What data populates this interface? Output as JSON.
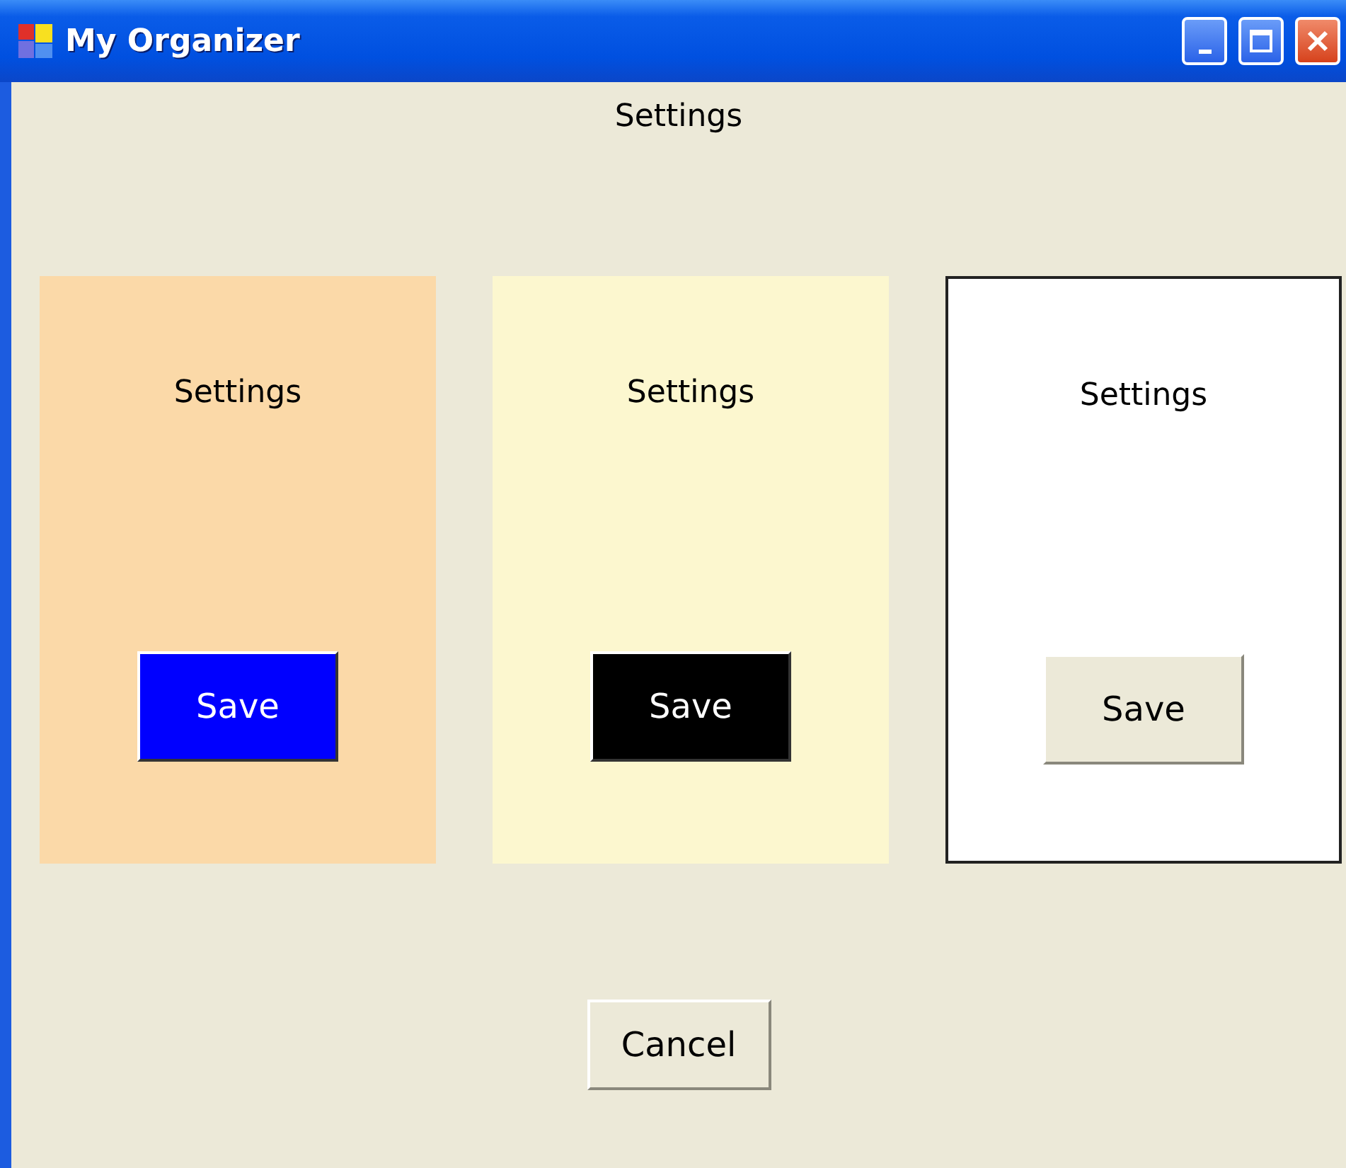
{
  "window": {
    "title": "My Organizer"
  },
  "heading": "Settings",
  "panels": [
    {
      "label": "Settings",
      "color": "#fbd9a8",
      "bordered": false,
      "button": {
        "label": "Save",
        "color": "#0000ff",
        "light_text": true,
        "raised": false
      }
    },
    {
      "label": "Settings",
      "color": "#fcf7cf",
      "bordered": false,
      "button": {
        "label": "Save",
        "color": "#000000",
        "light_text": true,
        "raised": false
      }
    },
    {
      "label": "Settings",
      "color": "#ffffff",
      "bordered": true,
      "button": {
        "label": "Save",
        "color": "#ece9d8",
        "light_text": false,
        "raised": true
      }
    }
  ],
  "cancel": {
    "label": "Cancel"
  }
}
